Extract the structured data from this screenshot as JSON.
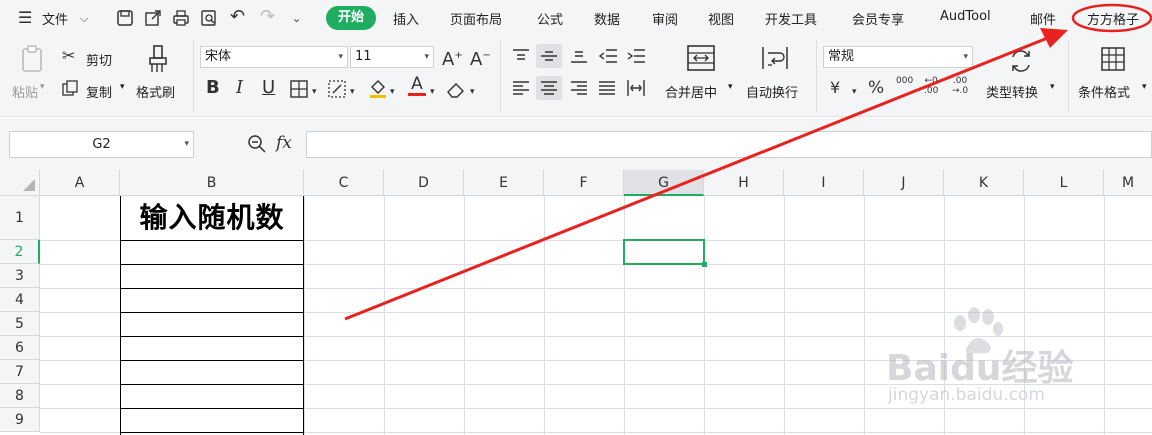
{
  "menu": {
    "file": "文件",
    "tabs": [
      "开始",
      "插入",
      "页面布局",
      "公式",
      "数据",
      "审阅",
      "视图",
      "开发工具",
      "会员专享",
      "AudTool",
      "邮件",
      "方方格子"
    ]
  },
  "ribbon": {
    "paste": "粘贴",
    "cut": "剪切",
    "copy": "复制",
    "format_painter": "格式刷",
    "font_name": "宋体",
    "font_size": "11",
    "merge_center": "合并居中",
    "auto_wrap": "自动换行",
    "number_format": "常规",
    "currency_symbol": "¥",
    "percent_symbol": "%",
    "type_convert": "类型转换",
    "conditional_format": "条件格式"
  },
  "formula_bar": {
    "cell_ref": "G2",
    "fx": "fx"
  },
  "sheet": {
    "columns": [
      "A",
      "B",
      "C",
      "D",
      "E",
      "F",
      "G",
      "H",
      "I",
      "J",
      "K",
      "L",
      "M"
    ],
    "rows": [
      "1",
      "2",
      "3",
      "4",
      "5",
      "6",
      "7",
      "8",
      "9"
    ],
    "selected_column": "G",
    "selected_row": "2",
    "b1_text": "输入随机数"
  },
  "watermark": {
    "logo": "Baidu经验",
    "url": "jingyan.baidu.com"
  },
  "colors": {
    "accent": "#1fae61",
    "annotation": "#e8231f"
  }
}
